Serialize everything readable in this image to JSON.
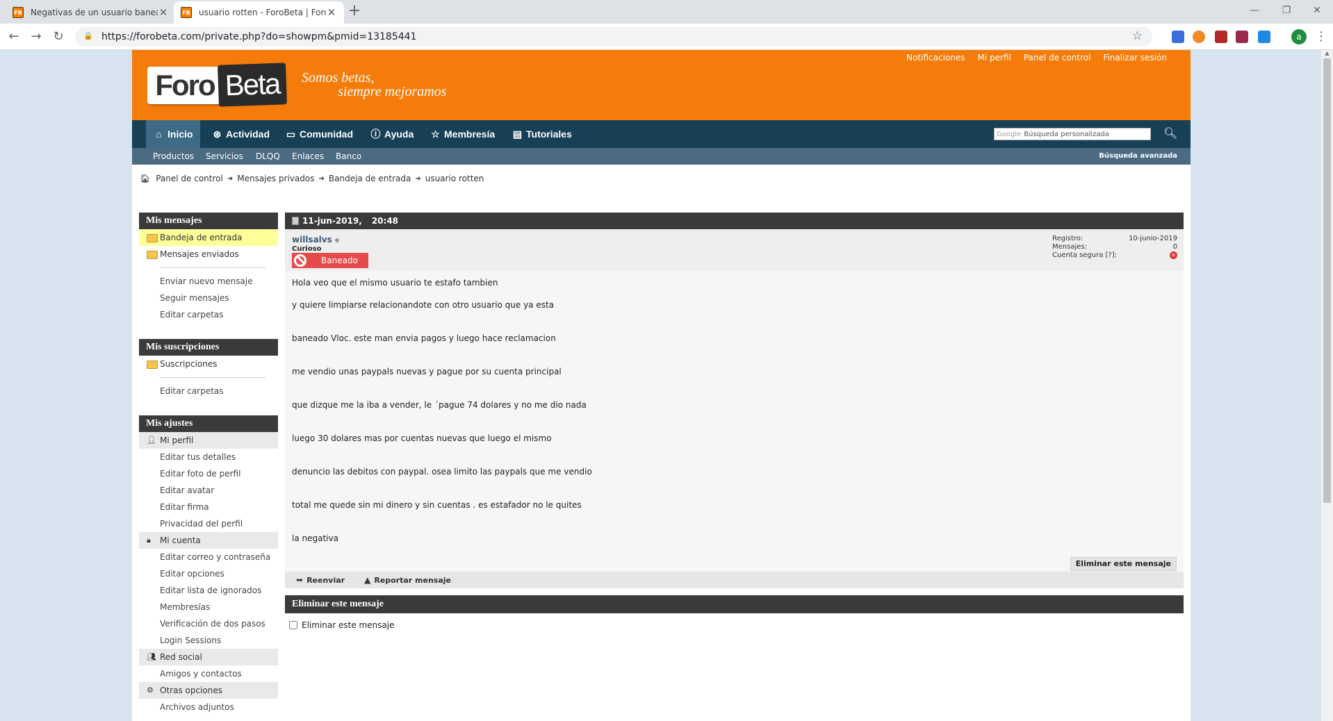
{
  "browser": {
    "tabs": [
      {
        "title": "Negativas de un usuario baneado",
        "active": false
      },
      {
        "title": "usuario rotten - ForoBeta | Foro de",
        "active": true
      }
    ],
    "url": "https://forobeta.com/private.php?do=showpm&pmid=13185441",
    "profile_initial": "a",
    "favicon_text": "FB"
  },
  "header": {
    "logo_foro": "Foro",
    "logo_beta": "Beta",
    "slogan_line1": "Somos betas,",
    "slogan_line2": "siempre mejoramos",
    "top_links": [
      "Notificaciones",
      "Mi perfil",
      "Panel de control",
      "Finalizar sesión"
    ]
  },
  "mainnav": {
    "items": [
      {
        "label": "Inicio",
        "icon": "home-icon"
      },
      {
        "label": "Actividad",
        "icon": "activity-icon"
      },
      {
        "label": "Comunidad",
        "icon": "chat-icon"
      },
      {
        "label": "Ayuda",
        "icon": "help-icon"
      },
      {
        "label": "Membresía",
        "icon": "star-icon"
      },
      {
        "label": "Tutoriales",
        "icon": "document-icon"
      }
    ],
    "search_brand": "Google",
    "search_placeholder": "Búsqueda personalizada"
  },
  "subnav": {
    "items": [
      "Productos",
      "Servicios",
      "DLQQ",
      "Enlaces",
      "Banco"
    ],
    "advanced_search": "Búsqueda avanzada"
  },
  "breadcrumb": [
    "Panel de control",
    "Mensajes privados",
    "Bandeja de entrada",
    "usuario rotten"
  ],
  "sidebar": {
    "mis_mensajes": {
      "title": "Mis mensajes",
      "folders": [
        "Bandeja de entrada",
        "Mensajes enviados"
      ],
      "links": [
        "Enviar nuevo mensaje",
        "Seguir mensajes",
        "Editar carpetas"
      ]
    },
    "mis_suscripciones": {
      "title": "Mis suscripciones",
      "folders": [
        "Suscripciones"
      ],
      "links": [
        "Editar carpetas"
      ]
    },
    "mis_ajustes": {
      "title": "Mis ajustes",
      "mi_perfil": "Mi perfil",
      "perfil_links": [
        "Editar tus detalles",
        "Editar foto de perfil",
        "Editar avatar",
        "Editar firma",
        "Privacidad del perfil"
      ],
      "mi_cuenta": "Mi cuenta",
      "cuenta_links": [
        "Editar correo y contraseña",
        "Editar opciones",
        "Editar lista de ignorados",
        "Membresías",
        "Verificación de dos pasos",
        "Login Sessions"
      ],
      "red_social": "Red social",
      "red_links": [
        "Amigos y contactos"
      ],
      "otras": "Otras opciones",
      "otras_links": [
        "Archivos adjuntos"
      ]
    }
  },
  "message": {
    "date": "11-jun-2019,",
    "time": "20:48",
    "username": "willsalvs",
    "user_title": "Curioso",
    "badge": "Baneado",
    "stats": {
      "registro_label": "Registro:",
      "registro_value": "10-junio-2019",
      "mensajes_label": "Mensajes:",
      "mensajes_value": "0",
      "cuenta_label": "Cuenta segura",
      "cuenta_hint": "[?]:"
    },
    "lines": [
      "Hola veo que el mismo usuario te estafo tambien",
      "y quiere limpiarse relacionandote con otro usuario que ya esta",
      "baneado Vloc. este man envia pagos y luego hace reclamacion",
      "me vendio unas paypals nuevas y pague por su cuenta principal",
      "que dizque me la iba a vender, le ´pague 74 dolares y no me dio nada",
      "luego 30 dolares mas por cuentas nuevas que luego el mismo",
      "denuncio las debitos con paypal. osea limito las paypals que me vendio",
      "total me quede sin mi dinero y sin cuentas . es estafador no le quites",
      "la negativa"
    ],
    "actions": {
      "forward": "Reenviar",
      "report": "Reportar mensaje"
    }
  },
  "delete_section": {
    "title": "Eliminar este mensaje",
    "checkbox_label": "Eliminar este mensaje",
    "button": "Eliminar este mensaje"
  }
}
